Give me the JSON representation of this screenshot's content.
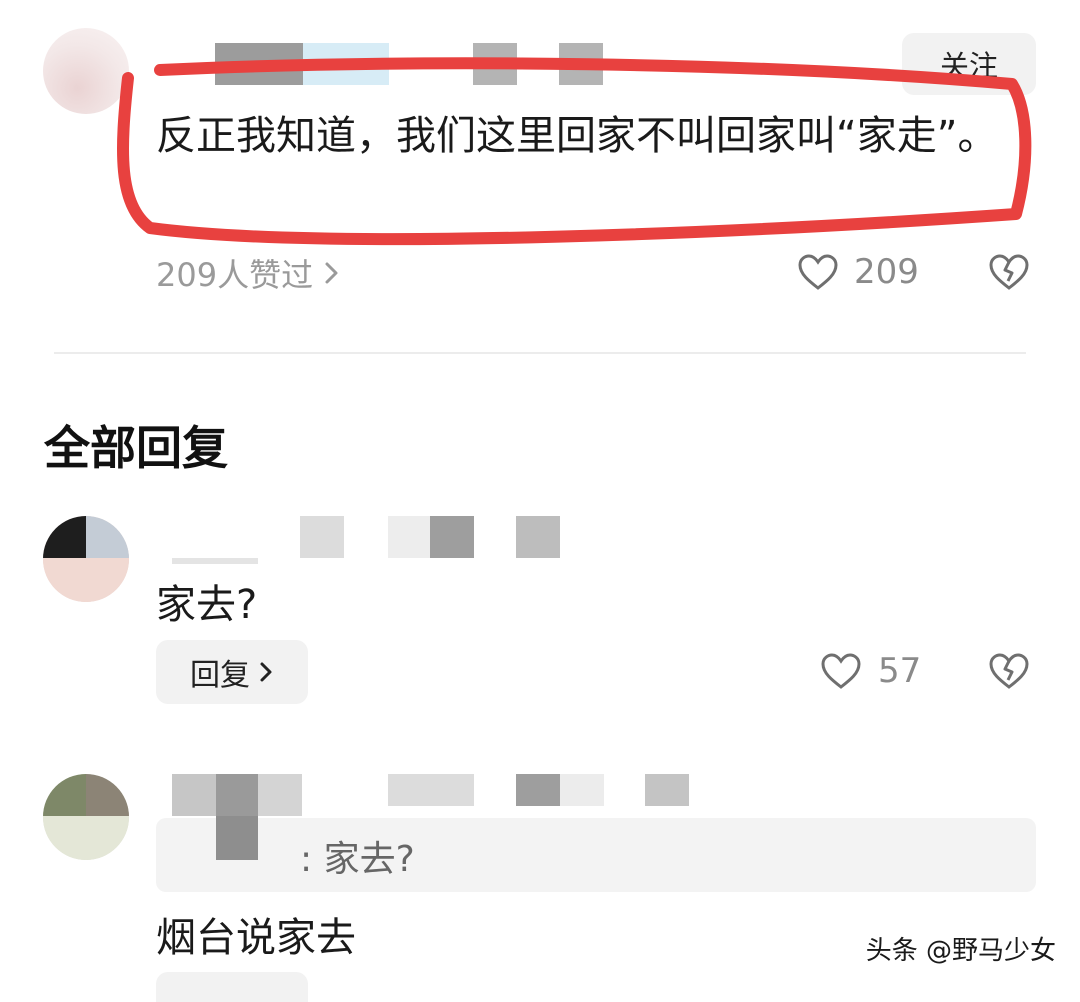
{
  "comment": {
    "follow_label": "关注",
    "text": "反正我知道，我们这里回家不叫回家叫“家走”。",
    "liked_by": "209人赞过",
    "like_count": "209"
  },
  "section": {
    "title": "全部回复"
  },
  "replies": [
    {
      "text": "家去?",
      "reply_label": "回复",
      "like_count": "57"
    },
    {
      "quote": ": 家去?",
      "text": "烟台说家去"
    }
  ],
  "watermark": "头条 @野马少女",
  "icons": {
    "like": "heart-outline-icon",
    "dislike": "broken-heart-icon",
    "chevron": "chevron-right-icon"
  },
  "colors": {
    "highlight": "#e8413f",
    "muted": "#9a9a9a"
  }
}
